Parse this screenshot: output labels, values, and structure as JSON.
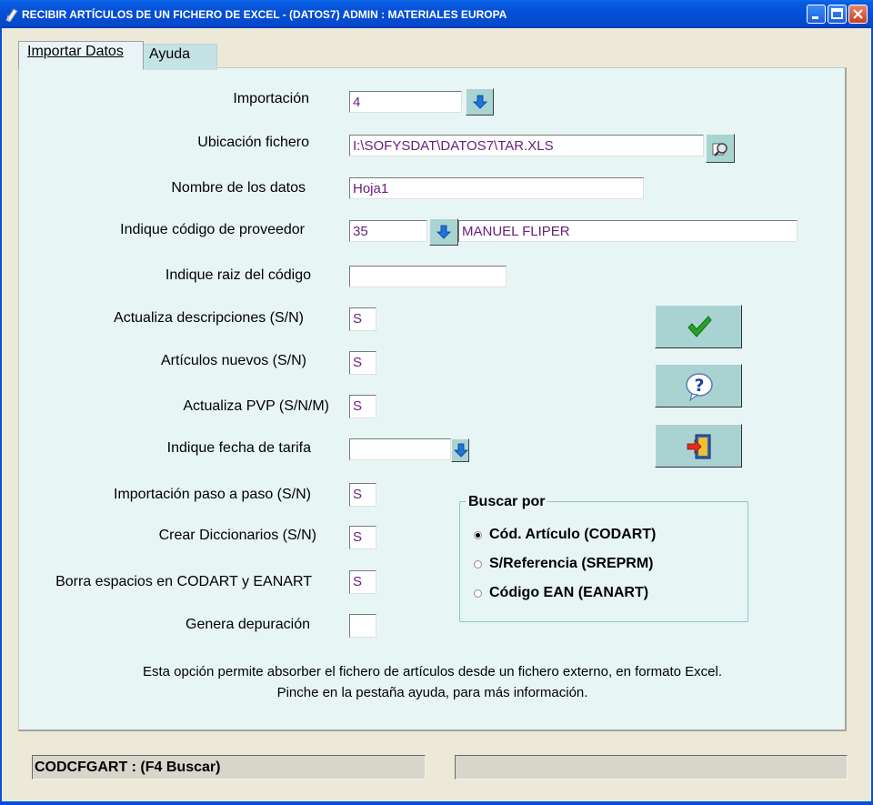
{
  "window": {
    "title": "RECIBIR ARTÍCULOS DE UN FICHERO DE EXCEL -  (DATOS7) ADMIN : MATERIALES EUROPA",
    "title_bar_color": "#0550d8"
  },
  "tabs": [
    {
      "label": "Importar Datos",
      "active": true
    },
    {
      "label": "Ayuda",
      "active": false
    }
  ],
  "form": {
    "importacion": {
      "label": "Importación",
      "value": "4"
    },
    "ubicacion": {
      "label": "Ubicación fichero",
      "value": "I:\\SOFYSDAT\\DATOS7\\TAR.XLS"
    },
    "nombre_datos": {
      "label": "Nombre de los datos",
      "value": "Hoja1"
    },
    "proveedor": {
      "label": "Indique código de proveedor",
      "value": "35",
      "name": "MANUEL FLIPER"
    },
    "raiz_codigo": {
      "label": "Indique raiz del código",
      "value": ""
    },
    "actualiza_desc": {
      "label": "Actualiza descripciones (S/N)",
      "value": "S"
    },
    "articulos_nuevos": {
      "label": "Artículos nuevos (S/N)",
      "value": "S"
    },
    "actualiza_pvp": {
      "label": "Actualiza PVP (S/N/M)",
      "value": "S"
    },
    "fecha_tarifa": {
      "label": "Indique fecha de tarifa",
      "value": ""
    },
    "paso_a_paso": {
      "label": "Importación paso a paso (S/N)",
      "value": "S"
    },
    "diccionarios": {
      "label": "Crear Diccionarios (S/N)",
      "value": "S"
    },
    "borra_espacios": {
      "label": "Borra espacios en CODART y EANART",
      "value": "S"
    },
    "depuracion": {
      "label": "Genera depuración",
      "value": ""
    }
  },
  "buttons": {
    "accept": "checkmark-icon",
    "help": "help-icon",
    "exit": "exit-door-icon"
  },
  "buscar_por": {
    "title": "Buscar por",
    "options": [
      {
        "label": "Cód. Artículo (CODART)",
        "selected": true
      },
      {
        "label": "S/Referencia (SREPRM)",
        "selected": false
      },
      {
        "label": "Código EAN  (EANART)",
        "selected": false
      }
    ]
  },
  "info": {
    "line1": "Esta opción permite absorber el fichero de artículos desde un fichero externo, en formato Excel.",
    "line2": "Pinche en la pestaña ayuda, para más información."
  },
  "status": {
    "left": "CODCFGART : (F4 Buscar)",
    "right": ""
  },
  "colors": {
    "panel_bg": "#e8f5f5",
    "button_bg": "#a9d3d3",
    "field_text": "#6a1e7a"
  }
}
